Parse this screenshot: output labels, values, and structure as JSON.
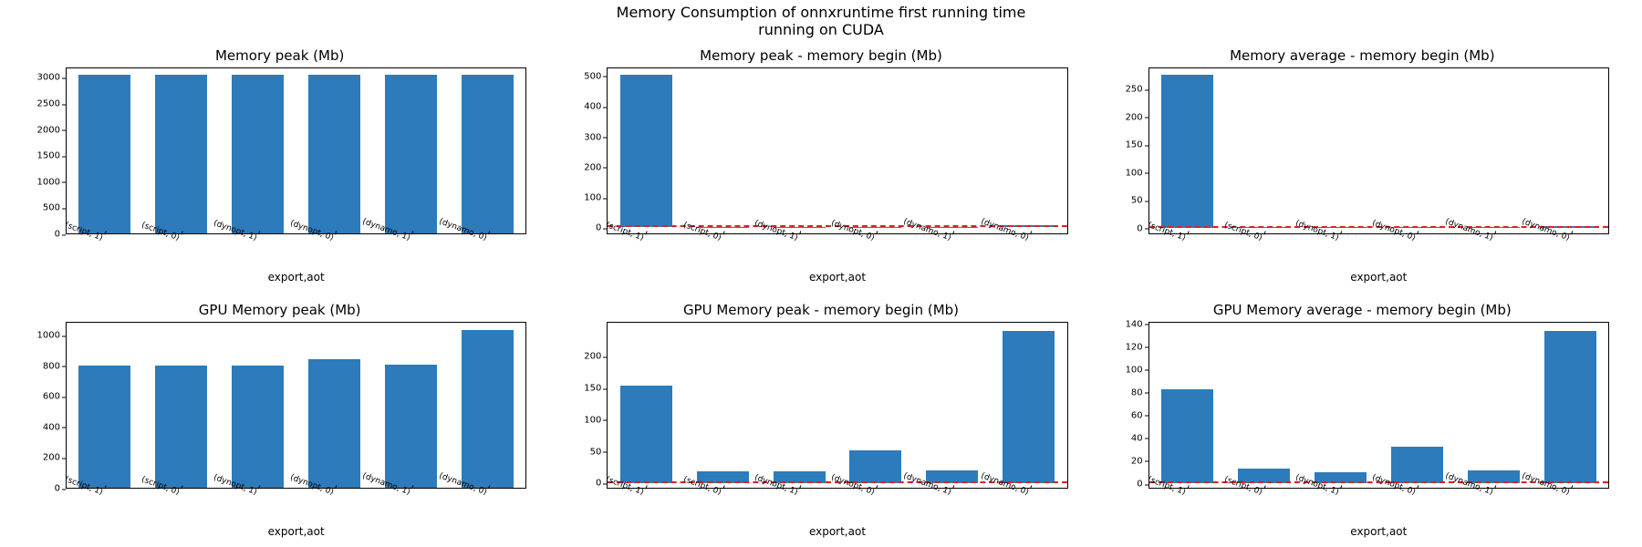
{
  "suptitle_line1": "Memory Consumption of onnxruntime first running time",
  "suptitle_line2": "running on CUDA",
  "xlabel": "export,aot",
  "categories": [
    "(script, 1)",
    "(script, 0)",
    "(dynopt, 1)",
    "(dynopt, 0)",
    "(dynamo, 1)",
    "(dynamo, 0)"
  ],
  "bar_color": "#2d7bba",
  "zero_line_color": "#e02020",
  "panels": [
    {
      "title": "Memory peak (Mb)",
      "values": [
        3080,
        3070,
        3080,
        3075,
        3070,
        3075
      ],
      "ymin": 0,
      "ymax": 3200,
      "yticks": [
        0,
        500,
        1000,
        1500,
        2000,
        2500,
        3000
      ],
      "zero_line": false
    },
    {
      "title": "Memory peak - memory begin (Mb)",
      "values": [
        510,
        2,
        2,
        2,
        2,
        8
      ],
      "ymin": -20,
      "ymax": 530,
      "yticks": [
        0,
        100,
        200,
        300,
        400,
        500
      ],
      "zero_line": true
    },
    {
      "title": "Memory average - memory begin (Mb)",
      "values": [
        278,
        1,
        1,
        1,
        1,
        4
      ],
      "ymin": -10,
      "ymax": 290,
      "yticks": [
        0,
        50,
        100,
        150,
        200,
        250
      ],
      "zero_line": true
    },
    {
      "title": "GPU Memory peak (Mb)",
      "values": [
        810,
        808,
        810,
        850,
        815,
        1040
      ],
      "ymin": 0,
      "ymax": 1090,
      "yticks": [
        0,
        200,
        400,
        600,
        800,
        1000
      ],
      "zero_line": false
    },
    {
      "title": "GPU Memory peak - memory begin (Mb)",
      "values": [
        155,
        18,
        18,
        52,
        20,
        242
      ],
      "ymin": -8,
      "ymax": 255,
      "yticks": [
        0,
        50,
        100,
        150,
        200
      ],
      "zero_line": true
    },
    {
      "title": "GPU Memory average - memory begin (Mb)",
      "values": [
        83,
        13,
        10,
        32,
        11,
        135
      ],
      "ymin": -4,
      "ymax": 142,
      "yticks": [
        0,
        20,
        40,
        60,
        80,
        100,
        120,
        140
      ],
      "zero_line": true
    }
  ],
  "chart_data": [
    {
      "type": "bar",
      "title": "Memory peak (Mb)",
      "categories": [
        "(script, 1)",
        "(script, 0)",
        "(dynopt, 1)",
        "(dynopt, 0)",
        "(dynamo, 1)",
        "(dynamo, 0)"
      ],
      "values": [
        3080,
        3070,
        3080,
        3075,
        3070,
        3075
      ],
      "xlabel": "export,aot",
      "ylabel": "",
      "ylim": [
        0,
        3200
      ]
    },
    {
      "type": "bar",
      "title": "Memory peak - memory begin (Mb)",
      "categories": [
        "(script, 1)",
        "(script, 0)",
        "(dynopt, 1)",
        "(dynopt, 0)",
        "(dynamo, 1)",
        "(dynamo, 0)"
      ],
      "values": [
        510,
        2,
        2,
        2,
        2,
        8
      ],
      "xlabel": "export,aot",
      "ylabel": "",
      "ylim": [
        -20,
        530
      ]
    },
    {
      "type": "bar",
      "title": "Memory average - memory begin (Mb)",
      "categories": [
        "(script, 1)",
        "(script, 0)",
        "(dynopt, 1)",
        "(dynopt, 0)",
        "(dynamo, 1)",
        "(dynamo, 0)"
      ],
      "values": [
        278,
        1,
        1,
        1,
        1,
        4
      ],
      "xlabel": "export,aot",
      "ylabel": "",
      "ylim": [
        -10,
        290
      ]
    },
    {
      "type": "bar",
      "title": "GPU Memory peak (Mb)",
      "categories": [
        "(script, 1)",
        "(script, 0)",
        "(dynopt, 1)",
        "(dynopt, 0)",
        "(dynamo, 1)",
        "(dynamo, 0)"
      ],
      "values": [
        810,
        808,
        810,
        850,
        815,
        1040
      ],
      "xlabel": "export,aot",
      "ylabel": "",
      "ylim": [
        0,
        1090
      ]
    },
    {
      "type": "bar",
      "title": "GPU Memory peak - memory begin (Mb)",
      "categories": [
        "(script, 1)",
        "(script, 0)",
        "(dynopt, 1)",
        "(dynopt, 0)",
        "(dynamo, 1)",
        "(dynamo, 0)"
      ],
      "values": [
        155,
        18,
        18,
        52,
        20,
        242
      ],
      "xlabel": "export,aot",
      "ylabel": "",
      "ylim": [
        -8,
        255
      ]
    },
    {
      "type": "bar",
      "title": "GPU Memory average - memory begin (Mb)",
      "categories": [
        "(script, 1)",
        "(script, 0)",
        "(dynopt, 1)",
        "(dynopt, 0)",
        "(dynamo, 1)",
        "(dynamo, 0)"
      ],
      "values": [
        83,
        13,
        10,
        32,
        11,
        135
      ],
      "xlabel": "export,aot",
      "ylabel": "",
      "ylim": [
        -4,
        142
      ]
    }
  ]
}
